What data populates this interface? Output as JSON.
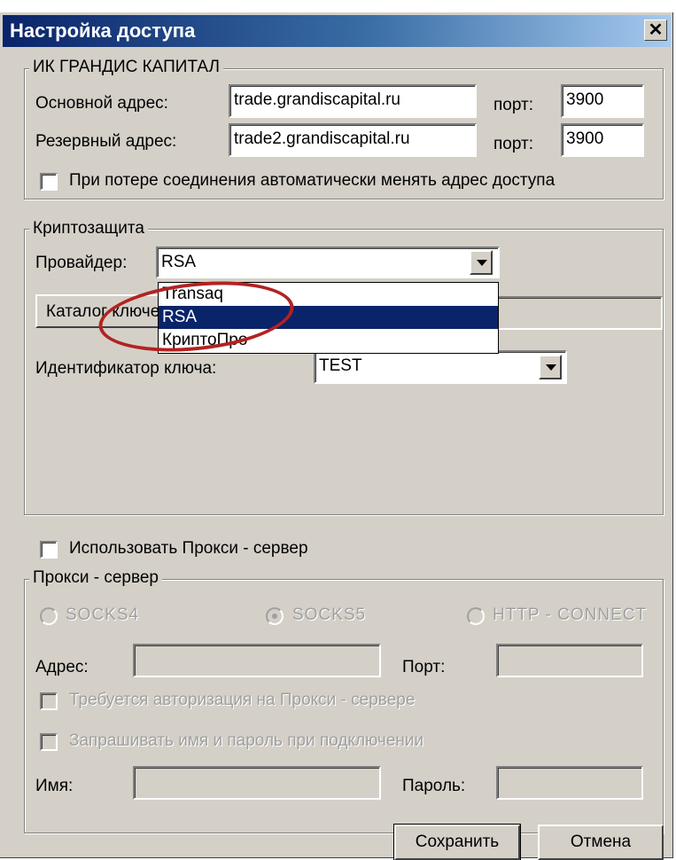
{
  "window": {
    "title": "Настройка доступа",
    "close_glyph": "✕"
  },
  "server_group": {
    "legend": "ИК ГРАНДИС КАПИТАЛ",
    "primary_label": "Основной адрес:",
    "primary_value": "trade.grandiscapital.ru",
    "primary_port_label": "порт:",
    "primary_port_value": "3900",
    "backup_label": "Резервный адрес:",
    "backup_value": "trade2.grandiscapital.ru",
    "backup_port_label": "порт:",
    "backup_port_value": "3900",
    "auto_switch_label": "При потере соединения автоматически менять адрес доступа",
    "auto_switch_checked": false
  },
  "crypto_group": {
    "legend": "Криптозащита",
    "provider_label": "Провайдер:",
    "provider_value": "RSA",
    "provider_options": [
      "Transaq",
      "RSA",
      "КриптоПро"
    ],
    "provider_selected_index": 1,
    "catalog_button_label": "Каталог ключей",
    "key_id_label": "Идентификатор ключа:",
    "key_id_value": "TEST"
  },
  "proxy": {
    "use_proxy_label": "Использовать Прокси - сервер",
    "use_proxy_checked": false,
    "legend": "Прокси - сервер",
    "radio_socks4": "SOCKS4",
    "radio_socks5": "SOCKS5",
    "radio_http": "HTTP - CONNECT",
    "selected": "SOCKS5",
    "address_label": "Адрес:",
    "port_label": "Порт:",
    "auth_label": "Требуется авторизация на Прокси - сервере",
    "ask_credentials_label": "Запрашивать имя и пароль при подключении",
    "name_label": "Имя:",
    "password_label": "Пароль:"
  },
  "footer": {
    "save_label": "Сохранить",
    "cancel_label": "Отмена"
  },
  "colors": {
    "face": "#d4d0c8",
    "title_start": "#0a246a",
    "title_end": "#a6caf0",
    "highlight": "#0a246a",
    "annotation": "#b22222"
  }
}
